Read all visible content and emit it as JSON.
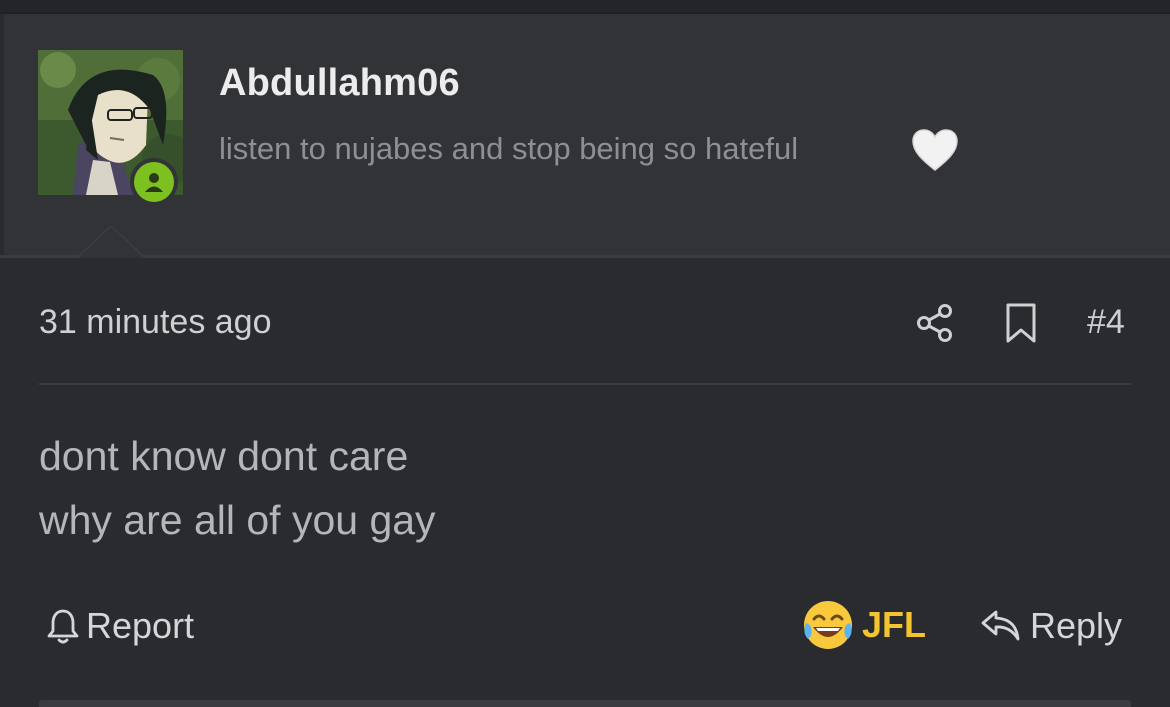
{
  "author": {
    "username": "Abdullahm06",
    "signature": "listen to nujabes and stop being so hateful",
    "avatar_icon": "avatar-anime-character",
    "status": "online",
    "status_color": "#7cc120"
  },
  "post": {
    "timestamp": "31 minutes ago",
    "number": "#4",
    "body": {
      "line1": "dont know dont care",
      "line2": "why are all of you gay"
    }
  },
  "actions": {
    "report_label": "Report",
    "reaction_label": "JFL",
    "reaction_icon": "face-with-tears-of-joy-icon",
    "reaction_color": "#f4c430",
    "reply_label": "Reply"
  },
  "icons": {
    "share": "share-icon",
    "bookmark": "bookmark-icon",
    "heart": "white-heart-icon",
    "bell": "bell-icon",
    "reply": "reply-arrow-icon"
  }
}
